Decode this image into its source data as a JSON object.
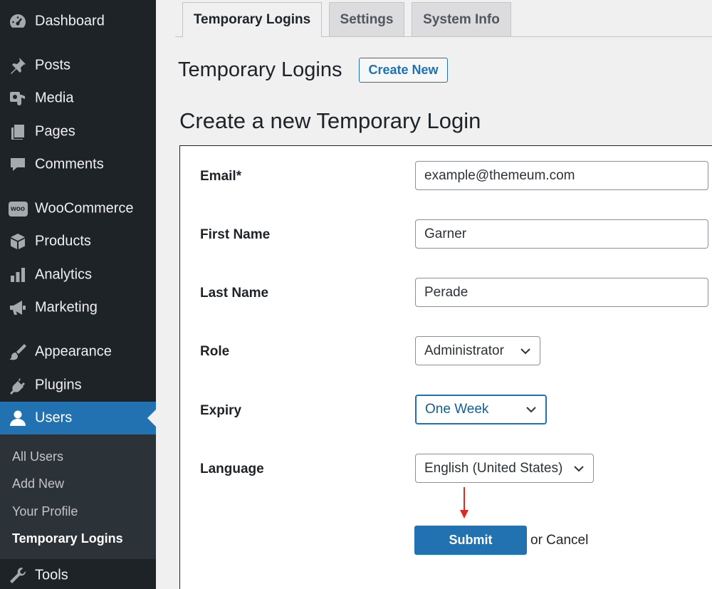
{
  "sidebar": {
    "items": [
      {
        "label": "Dashboard",
        "icon": "dashboard-icon"
      },
      {
        "label": "Posts",
        "icon": "pin-icon"
      },
      {
        "label": "Media",
        "icon": "media-icon"
      },
      {
        "label": "Pages",
        "icon": "pages-icon"
      },
      {
        "label": "Comments",
        "icon": "comment-icon"
      },
      {
        "label": "WooCommerce",
        "icon": "woo-icon",
        "icon_text": "woo"
      },
      {
        "label": "Products",
        "icon": "box-icon"
      },
      {
        "label": "Analytics",
        "icon": "bar-chart-icon"
      },
      {
        "label": "Marketing",
        "icon": "megaphone-icon"
      },
      {
        "label": "Appearance",
        "icon": "paintbrush-icon"
      },
      {
        "label": "Plugins",
        "icon": "plug-icon"
      },
      {
        "label": "Users",
        "icon": "user-icon",
        "active": true
      },
      {
        "label": "Tools",
        "icon": "wrench-icon"
      }
    ],
    "submenu": [
      {
        "label": "All Users"
      },
      {
        "label": "Add New"
      },
      {
        "label": "Your Profile"
      },
      {
        "label": "Temporary Logins",
        "current": true
      }
    ]
  },
  "tabs": [
    {
      "label": "Temporary Logins",
      "active": true
    },
    {
      "label": "Settings"
    },
    {
      "label": "System Info"
    }
  ],
  "header": {
    "title": "Temporary Logins",
    "create_new_label": "Create New"
  },
  "form": {
    "title": "Create a new Temporary Login",
    "email": {
      "label": "Email*",
      "value": "example@themeum.com"
    },
    "first_name": {
      "label": "First Name",
      "value": "Garner"
    },
    "last_name": {
      "label": "Last Name",
      "value": "Perade"
    },
    "role": {
      "label": "Role",
      "value": "Administrator"
    },
    "expiry": {
      "label": "Expiry",
      "value": "One Week"
    },
    "language": {
      "label": "Language",
      "value": "English (United States)"
    },
    "submit_label": "Submit",
    "cancel_text": "or Cancel"
  },
  "colors": {
    "sidebar_bg": "#1d2327",
    "accent": "#2271b1",
    "annotation_arrow": "#e0281e"
  }
}
